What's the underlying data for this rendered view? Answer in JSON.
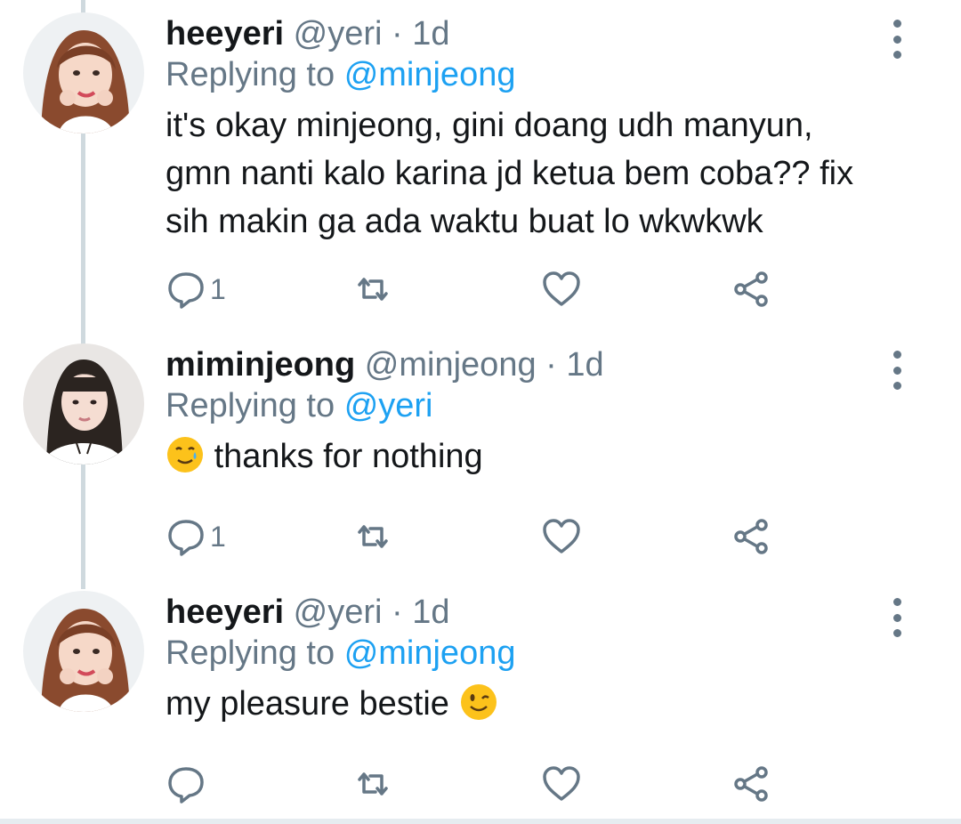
{
  "tweets": [
    {
      "name": "heeyeri",
      "handle": "@yeri",
      "dot": "·",
      "time": "1d",
      "replying_prefix": "Replying to",
      "replying_to": "@minjeong",
      "text": "it's okay minjeong, gini doang udh manyun,\ngmn nanti kalo karina jd ketua bem coba?? fix\nsih makin ga ada waktu buat lo wkwkwk",
      "reply_count": "1",
      "avatar_icon": "avatar-heeyeri"
    },
    {
      "name": "miminjeong",
      "handle": "@minjeong",
      "dot": "·",
      "time": "1d",
      "replying_prefix": "Replying to",
      "replying_to": "@yeri",
      "emoji_icon": "smiling-face-with-tear-emoji",
      "text": "thanks for nothing",
      "reply_count": "1",
      "avatar_icon": "avatar-miminjeong"
    },
    {
      "name": "heeyeri",
      "handle": "@yeri",
      "dot": "·",
      "time": "1d",
      "replying_prefix": "Replying to",
      "replying_to": "@minjeong",
      "text": "my pleasure bestie",
      "emoji_icon": "winking-face-emoji",
      "reply_count": "",
      "avatar_icon": "avatar-heeyeri"
    }
  ],
  "colors": {
    "accent": "#1da1f2",
    "secondary_text": "#657786",
    "thread_line": "#cfd9de"
  },
  "icons": [
    "reply-icon",
    "retweet-icon",
    "like-icon",
    "share-icon",
    "more-options-icon"
  ]
}
